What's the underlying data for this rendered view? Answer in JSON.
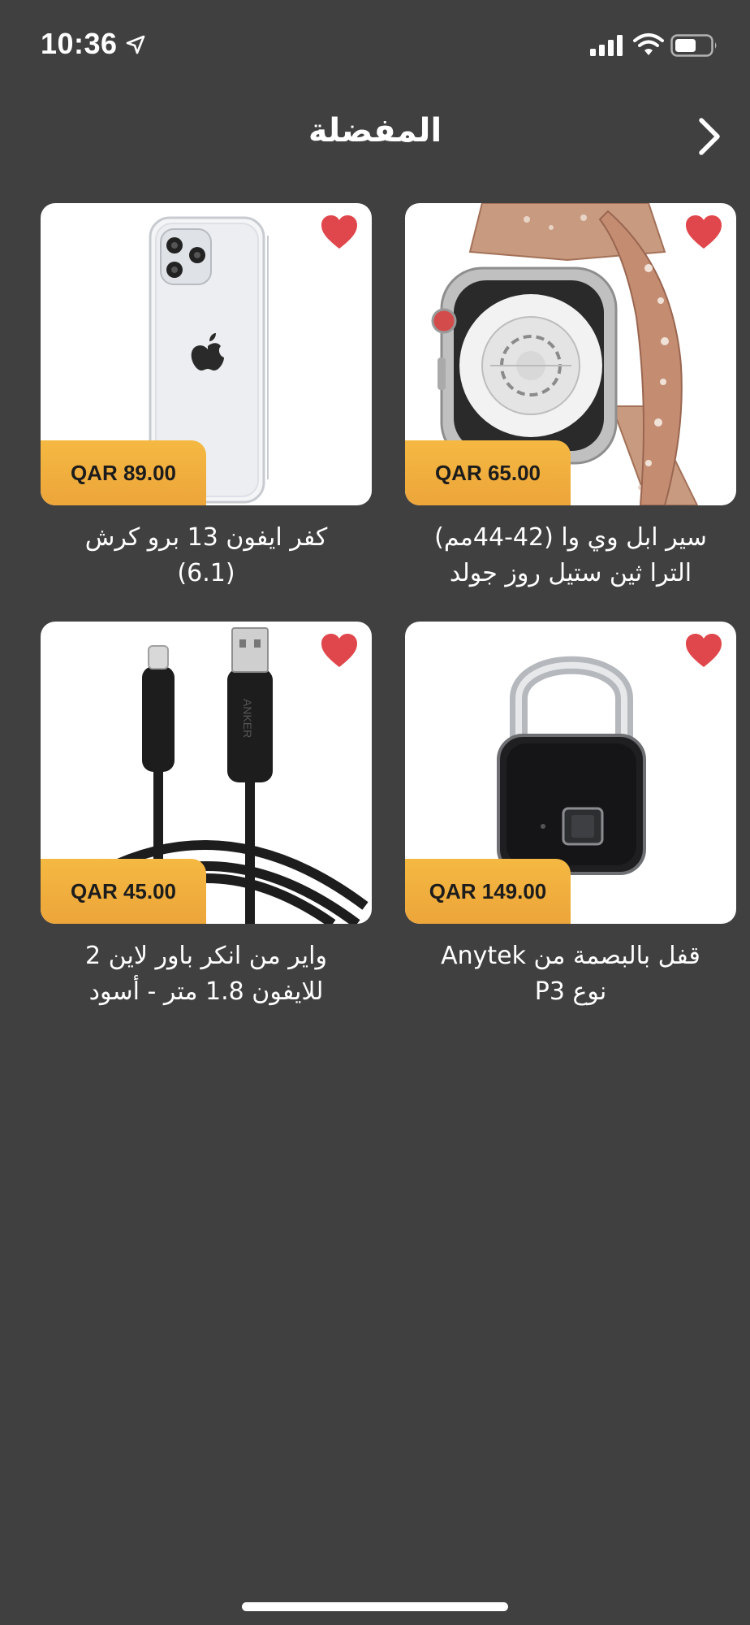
{
  "status_bar": {
    "time": "10:36"
  },
  "header": {
    "title": "المفضلة"
  },
  "products": [
    {
      "title_line1": "سير ابل وي وا (42-44مم)",
      "title_line2": "الترا ثين ستيل روز جولد",
      "price": "QAR 65.00",
      "favorited": true,
      "image": "rose-gold-watch-band"
    },
    {
      "title_line1": "كفر ايفون 13 برو كرش",
      "title_line2": "(6.1)",
      "price": "QAR 89.00",
      "favorited": true,
      "image": "iphone-clear-case"
    },
    {
      "title_line1": "قفل بالبصمة من Anytek",
      "title_line2": "نوع P3",
      "price": "QAR 149.00",
      "favorited": true,
      "image": "fingerprint-padlock"
    },
    {
      "title_line1": "واير من انكر باور لاين 2",
      "title_line2": "للايفون 1.8 متر - أسود",
      "price": "QAR 45.00",
      "favorited": true,
      "image": "anker-lightning-cable"
    }
  ],
  "colors": {
    "background": "#404040",
    "price_badge": "#f0ae3c",
    "heart": "#e0474c"
  }
}
